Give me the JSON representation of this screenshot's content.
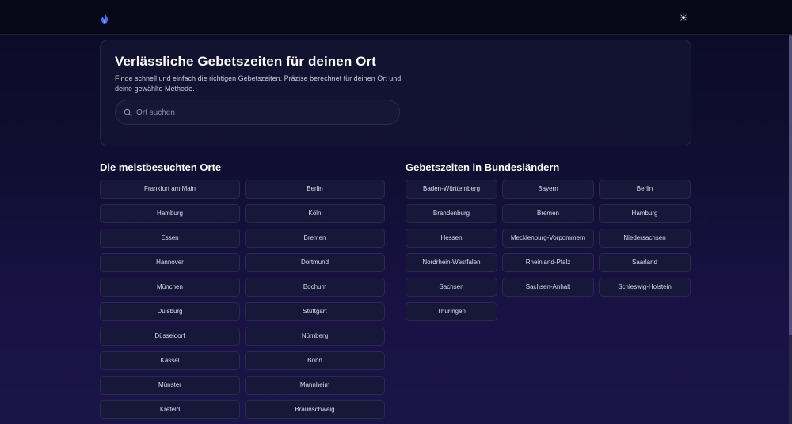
{
  "header": {
    "logo_icon": "drop-flame-icon",
    "theme_icon": "sun-icon"
  },
  "hero": {
    "title": "Verlässliche Gebetszeiten für deinen Ort",
    "subtitle": "Finde schnell und einfach die richtigen Gebetszeiten. Präzise berechnet für deinen Ort und deine gewählte Methode.",
    "search": {
      "placeholder": "Ort suchen",
      "value": ""
    }
  },
  "popular": {
    "title": "Die meistbesuchten Orte",
    "items": [
      "Frankfurt am Main",
      "Berlin",
      "Hamburg",
      "Köln",
      "Essen",
      "Bremen",
      "Hannover",
      "Dortmund",
      "München",
      "Bochum",
      "Duisburg",
      "Stuttgart",
      "Düsseldorf",
      "Nürnberg",
      "Kassel",
      "Bonn",
      "Münster",
      "Mannheim",
      "Krefeld",
      "Braunschweig"
    ]
  },
  "states": {
    "title": "Gebetszeiten in Bundesländern",
    "items": [
      "Baden-Württemberg",
      "Bayern",
      "Berlin",
      "Brandenburg",
      "Bremen",
      "Hamburg",
      "Hessen",
      "Mecklenburg-Vorpommern",
      "Niedersachsen",
      "Nordrhein-Westfalen",
      "Rheinland-Pfalz",
      "Saarland",
      "Sachsen",
      "Sachsen-Anhalt",
      "Schleswig-Holstein",
      "Thüringen"
    ]
  },
  "colors": {
    "background": "#110e33",
    "card": "#17173a",
    "accent": "#4a6cf7"
  }
}
